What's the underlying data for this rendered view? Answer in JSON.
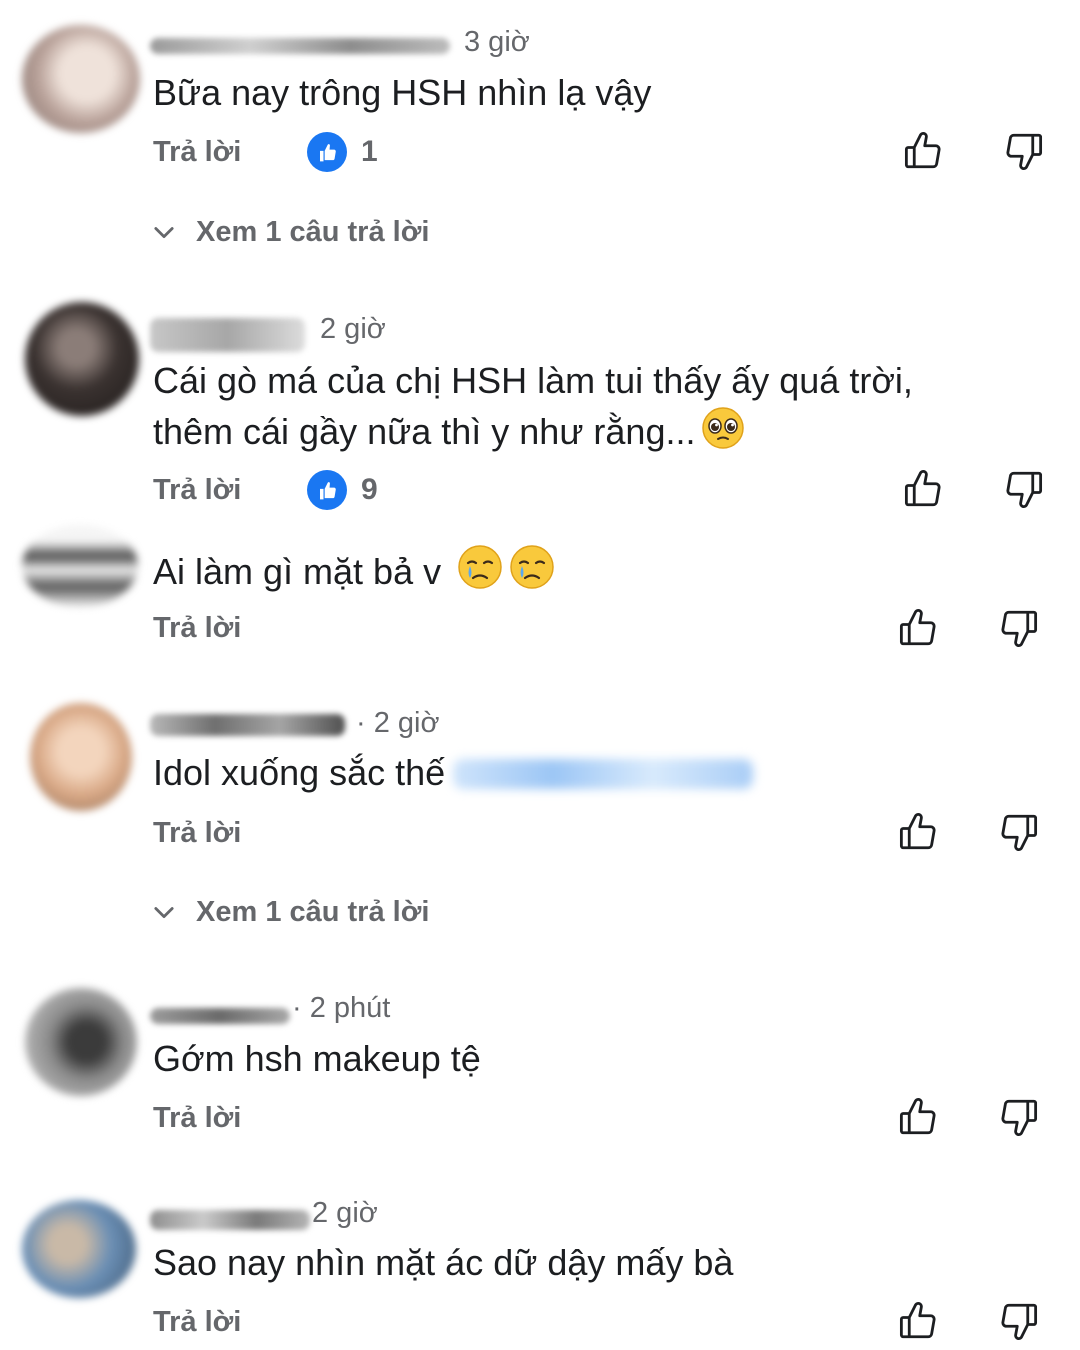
{
  "comments": [
    {
      "time": "3 giờ",
      "text": "Bữa nay trông HSH nhìn lạ vậy",
      "reply_label": "Trả lời",
      "like_count": "1",
      "view_replies": "Xem 1 câu trả lời",
      "avatar_colors": [
        "#d9c7bd",
        "#8e7a73"
      ]
    },
    {
      "time": "2 giờ",
      "text_line1": "Cái gò má của chị HSH làm tui thấy ấy quá trời,",
      "text_line2": "thêm cái gầy nữa thì y như rằng...",
      "reply_label": "Trả lời",
      "like_count": "9",
      "avatar_colors": [
        "#3a3230",
        "#8b7d78"
      ]
    },
    {
      "text": "Ai làm gì mặt bả v",
      "reply_label": "Trả lời",
      "avatar_colors": [
        "#f2f2f2",
        "#555555"
      ]
    },
    {
      "time": "· 2 giờ",
      "text": "Idol xuống sắc thế",
      "reply_label": "Trả lời",
      "view_replies": "Xem 1 câu trả lời",
      "avatar_colors": [
        "#e8c1a2",
        "#9c7a5d"
      ]
    },
    {
      "time": "· 2 phút",
      "text": "Gớm hsh makeup tệ",
      "reply_label": "Trả lời",
      "avatar_colors": [
        "#cfcfcf",
        "#3b3b3b"
      ]
    },
    {
      "time": "2 giờ",
      "text": "Sao nay nhìn mặt ác dữ dậy mấy bà",
      "reply_label": "Trả lời",
      "avatar_colors": [
        "#6b8fb5",
        "#c9b9a7"
      ]
    }
  ],
  "colors": {
    "accent": "#1a77f2",
    "secondary_text": "#65676b",
    "primary_text": "#1c1e21"
  },
  "icons": [
    "thumbs-up-icon",
    "thumbs-down-icon",
    "like-badge-icon",
    "chevron-down-icon",
    "pleading-face-emoji",
    "crying-face-emoji"
  ]
}
